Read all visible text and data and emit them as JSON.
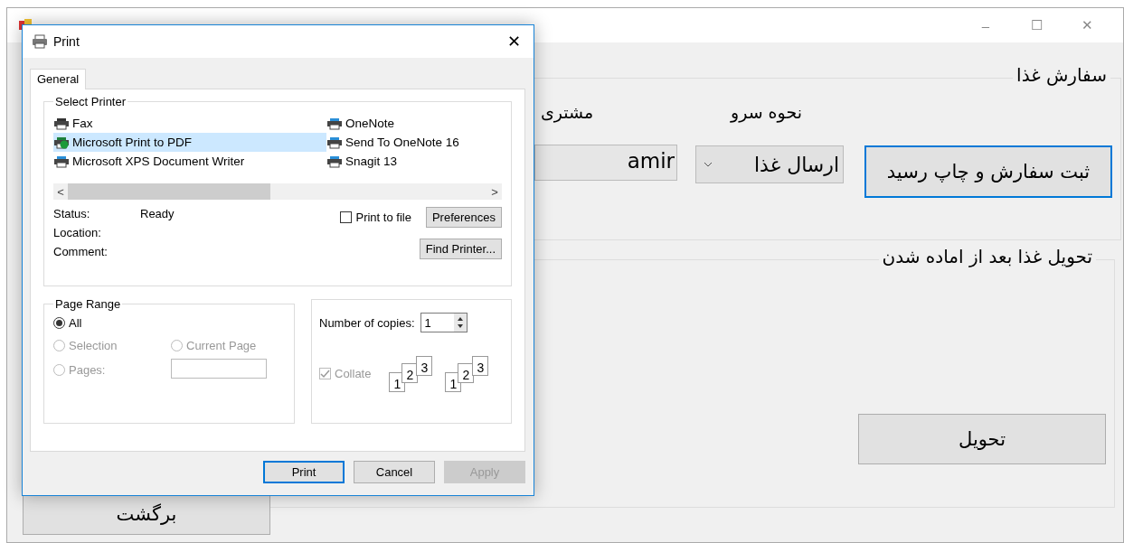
{
  "main_window": {
    "controls": [
      "–",
      "☐",
      "✕"
    ],
    "order_group": {
      "title": "سفارش غذا",
      "customer_label": "مشتری",
      "serve_label": "نحوه سرو",
      "customer_value": "amir",
      "serve_value": "ارسال غذا",
      "submit_button": "ثبت سفارش و چاپ رسید"
    },
    "delivery_group": {
      "title": "تحویل غذا بعد از اماده شدن",
      "deliver_button": "تحویل"
    },
    "back_button": "برگشت"
  },
  "print_dialog": {
    "title": "Print",
    "close": "✕",
    "tabs": [
      {
        "label": "General",
        "selected": true
      }
    ],
    "select_printer": {
      "title": "Select Printer",
      "printers": [
        {
          "name": "Fax",
          "kind": "fax",
          "selected": false
        },
        {
          "name": "Microsoft Print to PDF",
          "kind": "default",
          "selected": true
        },
        {
          "name": "Microsoft XPS Document Writer",
          "kind": "printer",
          "selected": false
        },
        {
          "name": "OneNote",
          "kind": "printer",
          "selected": false
        },
        {
          "name": "Send To OneNote 16",
          "kind": "printer",
          "selected": false
        },
        {
          "name": "Snagit 13",
          "kind": "printer",
          "selected": false
        }
      ],
      "scroll_left": "<",
      "scroll_right": ">",
      "status_label": "Status:",
      "status_value": "Ready",
      "location_label": "Location:",
      "comment_label": "Comment:",
      "print_to_file": {
        "label": "Print to file",
        "checked": false
      },
      "preferences_button": "Preferences",
      "find_printer_button": "Find Printer..."
    },
    "page_range": {
      "title": "Page Range",
      "options": [
        {
          "label": "All",
          "selected": true,
          "disabled": false
        },
        {
          "label": "Selection",
          "selected": false,
          "disabled": true
        },
        {
          "label": "Current Page",
          "selected": false,
          "disabled": true
        },
        {
          "label": "Pages:",
          "selected": false,
          "disabled": true
        }
      ]
    },
    "copies": {
      "label": "Number of copies:",
      "value": "1",
      "collate": {
        "label": "Collate",
        "checked": true,
        "disabled": true
      },
      "page_stacks": [
        [
          "1",
          "2",
          "3"
        ],
        [
          "1",
          "2",
          "3"
        ]
      ]
    },
    "buttons": [
      {
        "label": "Print",
        "kind": "default",
        "disabled": false
      },
      {
        "label": "Cancel",
        "kind": "normal",
        "disabled": false
      },
      {
        "label": "Apply",
        "kind": "normal",
        "disabled": true
      }
    ]
  }
}
